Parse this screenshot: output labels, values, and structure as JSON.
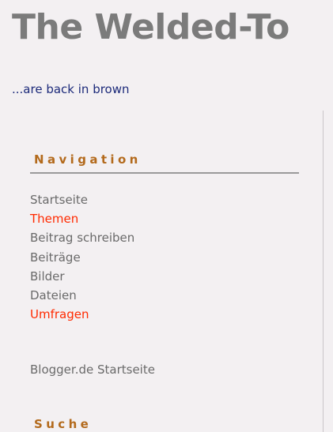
{
  "header": {
    "title": "The Welded-To",
    "tagline": "...are back in brown"
  },
  "sidebar": {
    "navigation_heading": "Navigation",
    "nav_items": [
      {
        "label": "Startseite",
        "active": false
      },
      {
        "label": "Themen",
        "active": true
      },
      {
        "label": "Beitrag schreiben",
        "active": false
      },
      {
        "label": "Beiträge",
        "active": false
      },
      {
        "label": "Bilder",
        "active": false
      },
      {
        "label": "Dateien",
        "active": false
      },
      {
        "label": "Umfragen",
        "active": true
      }
    ],
    "blogger_link": "Blogger.de Startseite",
    "search_heading": "Suche"
  },
  "colors": {
    "background": "#f3f0f2",
    "title": "#7b7b7b",
    "tagline": "#1c2a7a",
    "heading": "#b36a1c",
    "link": "#6a6a6a",
    "link_highlight": "#ff2a00"
  }
}
